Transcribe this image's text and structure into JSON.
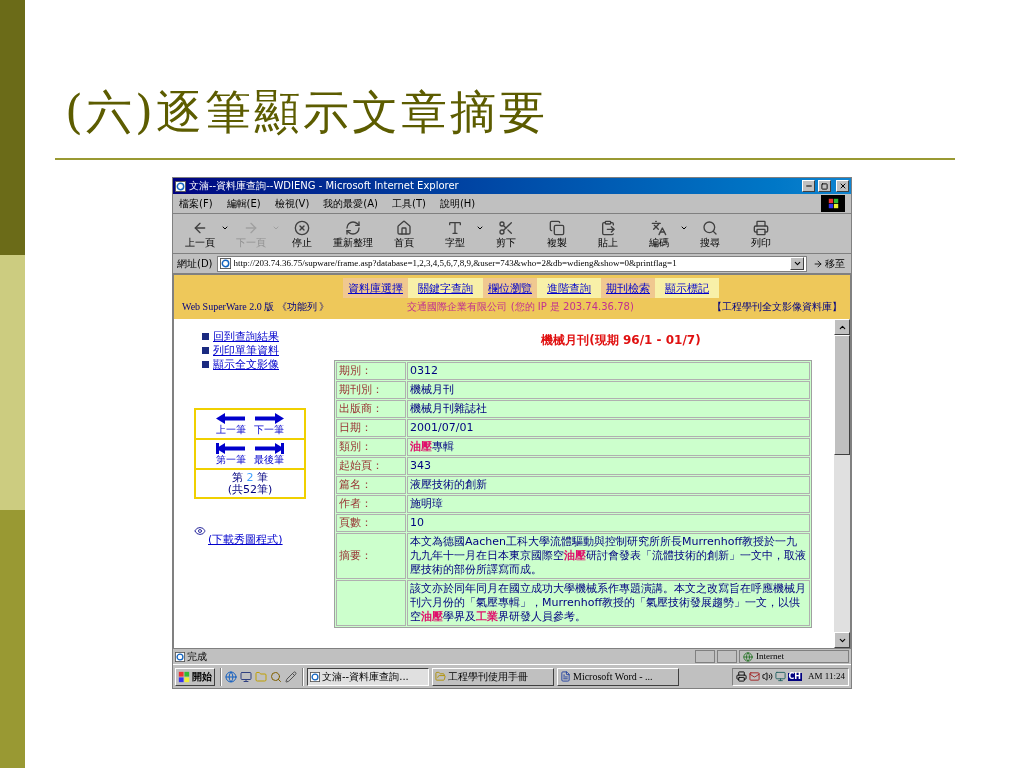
{
  "slide": {
    "title": "(六)逐筆顯示文章摘要"
  },
  "window": {
    "title": "文湳--資料庫查詢--WDIENG - Microsoft Internet Explorer"
  },
  "menu": [
    "檔案(F)",
    "編輯(E)",
    "檢視(V)",
    "我的最愛(A)",
    "工具(T)",
    "說明(H)"
  ],
  "toolbar": [
    {
      "label": "上一頁",
      "disabled": false,
      "dropdown": true
    },
    {
      "label": "下一頁",
      "disabled": true,
      "dropdown": true
    },
    {
      "label": "停止",
      "disabled": false,
      "dropdown": false
    },
    {
      "label": "重新整理",
      "disabled": false,
      "dropdown": false
    },
    {
      "label": "首頁",
      "disabled": false,
      "dropdown": false
    },
    {
      "label": "字型",
      "disabled": false,
      "dropdown": true
    },
    {
      "label": "剪下",
      "disabled": false,
      "dropdown": false
    },
    {
      "label": "複製",
      "disabled": false,
      "dropdown": false
    },
    {
      "label": "貼上",
      "disabled": false,
      "dropdown": false
    },
    {
      "label": "編碼",
      "disabled": false,
      "dropdown": true
    },
    {
      "label": "搜尋",
      "disabled": false,
      "dropdown": false
    },
    {
      "label": "列印",
      "disabled": false,
      "dropdown": false
    }
  ],
  "address": {
    "label": "網址(D)",
    "url": "http://203.74.36.75/supware/frame.asp?database=1,2,3,4,5,6,7,8,9,&user=743&who=2&db=wdieng&show=0&printflag=1",
    "go": "移至"
  },
  "site_nav": [
    "資料庫選擇",
    "關鍵字查詢",
    "欄位瀏覽",
    "進階查詢",
    "期刊檢索",
    "顯示標記"
  ],
  "site_header": {
    "left": "Web SuperWare 2.0 版 《功能列 》",
    "center": "交通國際企業有限公司 (您的 IP 是 203.74.36.78)",
    "right": "【工程學刊全文影像資料庫】"
  },
  "side_links": [
    "回到查詢結果",
    "列印單筆資料",
    "顯示全文影像"
  ],
  "record_nav": {
    "buttons": [
      "上一筆",
      "下一筆",
      "第一筆",
      "最後筆"
    ],
    "counter_prefix": "第",
    "counter_number": "2",
    "counter_suffix": "筆",
    "total": "(共52筆)"
  },
  "download_link": "(下載秀圖程式)",
  "record": {
    "title": "機械月刊(現期 96/1 - 01/7)",
    "rows": [
      {
        "label": "期別：",
        "value": "0312"
      },
      {
        "label": "期刊別：",
        "value": "機械月刊"
      },
      {
        "label": "出版商：",
        "value": "機械月刊雜誌社"
      },
      {
        "label": "日期：",
        "value": "2001/07/01"
      },
      {
        "label": "類別：",
        "value": "**油壓**專輯"
      },
      {
        "label": "起始頁：",
        "value": "343"
      },
      {
        "label": "篇名：",
        "value": "液壓技術的創新"
      },
      {
        "label": "作者：",
        "value": "施明璋"
      },
      {
        "label": "頁數：",
        "value": "10"
      },
      {
        "label": "摘要：",
        "value": "本文為德國Aachen工科大學流體驅動與控制研究所所長Murrenhoff教授於一九九九年十一月在日本東京國際空**油壓**研討會發表「流體技術的創新」一文中，取液壓技術的部份所譯寫而成。"
      },
      {
        "value": "該文亦於同年同月在國立成功大學機械系作專題演講。本文之改寫旨在呼應機械月刊六月份的「氣壓專輯」，Murrenhoff教授的「氣壓技術發展趨勢」一文，以供空**油壓**學界及**工業**界研發人員參考。"
      }
    ]
  },
  "status_bar": {
    "text": "完成",
    "zone": "Internet"
  },
  "taskbar": {
    "start": "開始",
    "tasks": [
      {
        "label": "文湳--資料庫查詢...",
        "selected": true
      },
      {
        "label": "工程學刊使用手冊",
        "selected": false
      },
      {
        "label": "Microsoft Word - ...",
        "selected": false
      }
    ],
    "ime": "CH",
    "clock": "AM 11:24"
  }
}
